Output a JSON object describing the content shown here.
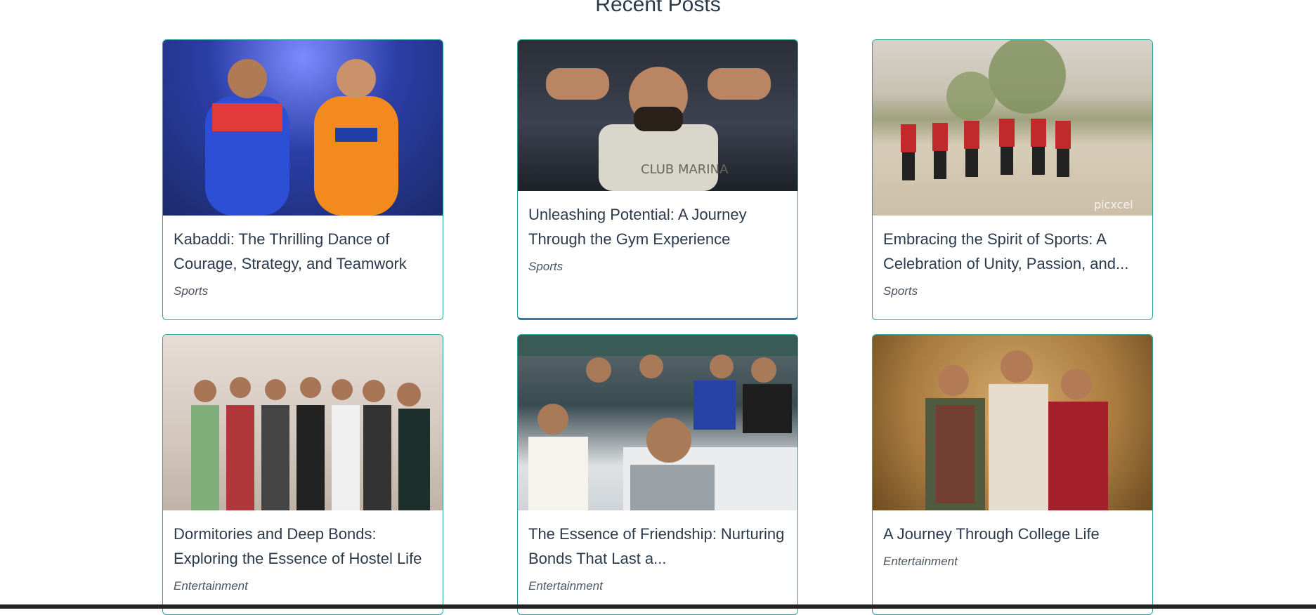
{
  "section_title": "Recent Posts",
  "posts": [
    {
      "title": "Kabaddi: The Thrilling Dance of Courage, Strategy, and Teamwork",
      "category": "Sports"
    },
    {
      "title": "Unleashing Potential: A Journey Through the Gym Experience",
      "category": "Sports"
    },
    {
      "title": "Embracing the Spirit of Sports: A Celebration of Unity, Passion, and...",
      "category": "Sports"
    },
    {
      "title": "Dormitories and Deep Bonds: Exploring the Essence of Hostel Life",
      "category": "Entertainment"
    },
    {
      "title": "The Essence of Friendship: Nurturing Bonds That Last a...",
      "category": "Entertainment"
    },
    {
      "title": "A Journey Through College Life",
      "category": "Entertainment"
    }
  ],
  "colors": {
    "card_border": "#2ba59a",
    "title_text": "#2c3a4b"
  }
}
